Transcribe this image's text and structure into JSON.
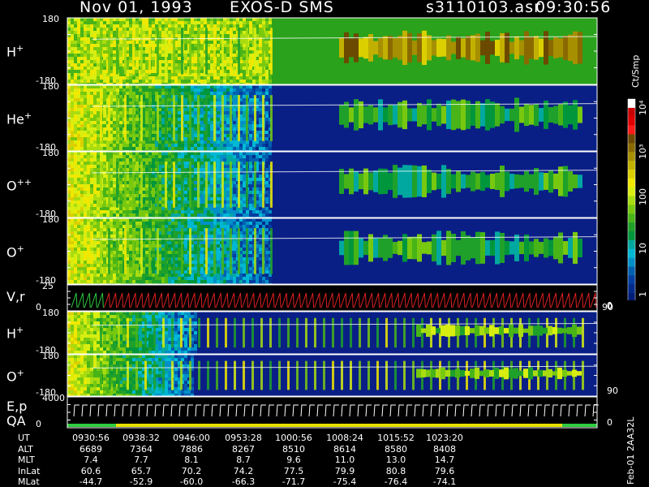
{
  "header": {
    "date": "Nov 01, 1993",
    "mission": "EXOS-D SMS",
    "file": "s3110103.asr",
    "time": "09:30:56"
  },
  "panels": [
    {
      "species": "H",
      "charge": "+",
      "ymax": "180",
      "ymin": "-180",
      "kind": "spec",
      "fill": "green"
    },
    {
      "species": "He",
      "charge": "+",
      "ymax": "180",
      "ymin": "-180",
      "kind": "spec",
      "fill": "blue"
    },
    {
      "species": "O",
      "charge": "++",
      "ymax": "180",
      "ymin": "-180",
      "kind": "spec",
      "fill": "blue"
    },
    {
      "species": "O",
      "charge": "+",
      "ymax": "180",
      "ymin": "-180",
      "kind": "spec",
      "fill": "blue"
    },
    {
      "species": "V,r",
      "charge": "",
      "ymax": "25",
      "ymin": "0",
      "kind": "vr",
      "fill": "black",
      "right_top": "90",
      "right_bottom": "0"
    },
    {
      "species": "H",
      "charge": "+",
      "ymax": "180",
      "ymin": "-180",
      "kind": "spec2",
      "fill": "blue"
    },
    {
      "species": "O",
      "charge": "+",
      "ymax": "180",
      "ymin": "-180",
      "kind": "spec2b",
      "fill": "blue",
      "right_bottom": "90"
    },
    {
      "species": "E,p",
      "charge": "",
      "species2": "QA",
      "ymax": "4000",
      "ymin": "0",
      "kind": "ep",
      "fill": "black",
      "right_bottom": "0"
    }
  ],
  "colorbar": {
    "unit": "Ct/Smp",
    "labels": [
      "10⁴",
      "10³",
      "100",
      "10",
      "1"
    ],
    "bottom_label": "0",
    "colors": [
      "#ffffff",
      "#cc0000",
      "#e00000",
      "#ff1a1a",
      "#6b4a00",
      "#8a6a00",
      "#a68f00",
      "#c2b000",
      "#dccf00",
      "#f0e800",
      "#d8ee10",
      "#a8dc10",
      "#78c810",
      "#48b418",
      "#1fa02a",
      "#00963c",
      "#00a8a0",
      "#00b8d4",
      "#0090c8",
      "#0060b0",
      "#003fa0",
      "#002b8c",
      "#001c78"
    ]
  },
  "ephemeris": {
    "labels": [
      "UT",
      "ALT",
      "MLT",
      "InLat",
      "MLat"
    ],
    "columns": [
      {
        "UT": "0930:56",
        "ALT": "6689",
        "MLT": "7.4",
        "InLat": "60.6",
        "MLat": "-44.7"
      },
      {
        "UT": "0938:32",
        "ALT": "7364",
        "MLT": "7.7",
        "InLat": "65.7",
        "MLat": "-52.9"
      },
      {
        "UT": "0946:00",
        "ALT": "7886",
        "MLT": "8.1",
        "InLat": "70.2",
        "MLat": "-60.0"
      },
      {
        "UT": "0953:28",
        "ALT": "8267",
        "MLT": "8.7",
        "InLat": "74.2",
        "MLat": "-66.3"
      },
      {
        "UT": "1000:56",
        "ALT": "8510",
        "MLT": "9.6",
        "InLat": "77.5",
        "MLat": "-71.7"
      },
      {
        "UT": "1008:24",
        "ALT": "8614",
        "MLT": "11.0",
        "InLat": "79.9",
        "MLat": "-75.4"
      },
      {
        "UT": "1015:52",
        "ALT": "8580",
        "MLT": "13.0",
        "InLat": "80.8",
        "MLat": "-76.4"
      },
      {
        "UT": "1023:20",
        "ALT": "8408",
        "MLT": "14.7",
        "InLat": "79.6",
        "MLat": "-74.1"
      }
    ]
  },
  "footer": {
    "stamp": "Feb-01 2AA32L"
  },
  "chart_data": {
    "type": "heatmap",
    "title": "Nov 01, 1993   EXOS-D SMS",
    "xlabel": "UT",
    "x_ticks": [
      "0930:56",
      "0938:32",
      "0946:00",
      "0953:28",
      "1000:56",
      "1008:24",
      "1015:52",
      "1023:20"
    ],
    "series": [
      {
        "name": "H+",
        "ylim": [
          -180,
          180
        ]
      },
      {
        "name": "He+",
        "ylim": [
          -180,
          180
        ]
      },
      {
        "name": "O++",
        "ylim": [
          -180,
          180
        ]
      },
      {
        "name": "O+",
        "ylim": [
          -180,
          180
        ]
      },
      {
        "name": "V,r",
        "ylim": [
          0,
          25
        ]
      },
      {
        "name": "H+",
        "ylim": [
          -180,
          180
        ]
      },
      {
        "name": "O+",
        "ylim": [
          -180,
          180
        ]
      },
      {
        "name": "E,p",
        "ylim": [
          0,
          4000
        ]
      }
    ],
    "colorscale": {
      "unit": "Ct/Smp",
      "range": [
        1,
        10000
      ],
      "scale": "log"
    }
  }
}
